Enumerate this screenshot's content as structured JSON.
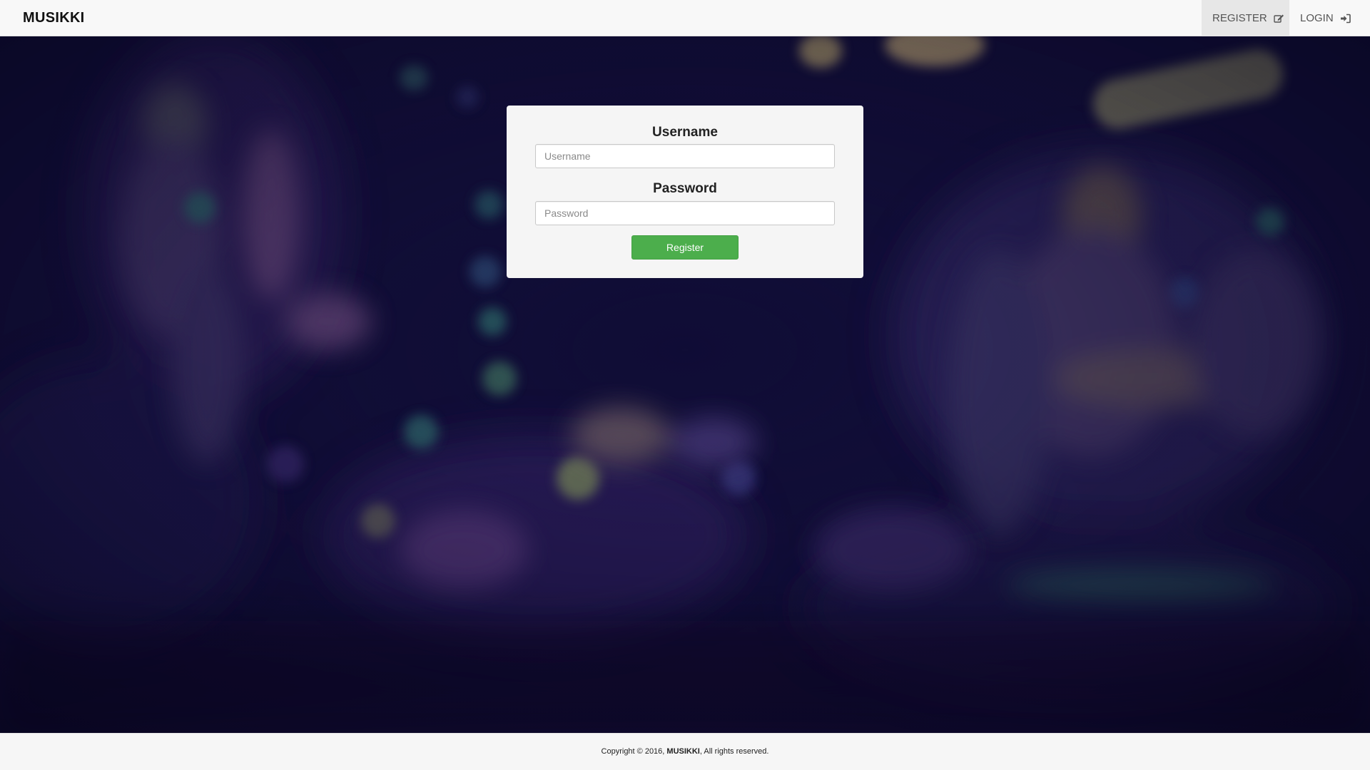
{
  "app": {
    "brand": "MUSIKKI"
  },
  "nav": {
    "items": [
      {
        "label": "REGISTER",
        "icon": "edit-icon",
        "active": true
      },
      {
        "label": "LOGIN",
        "icon": "sign-in-icon",
        "active": false
      }
    ]
  },
  "form": {
    "username_label": "Username",
    "username_placeholder": "Username",
    "username_value": "",
    "password_label": "Password",
    "password_placeholder": "Password",
    "password_value": "",
    "submit_label": "Register"
  },
  "footer": {
    "prefix": "Copyright © 2016, ",
    "brand": "MUSIKKI",
    "suffix": ", All rights reserved."
  },
  "colors": {
    "navbar_bg": "#f8f8f8",
    "active_nav_bg": "#e7e7e7",
    "card_bg": "#f5f5f5",
    "button_green": "#4cae4c",
    "background_dark": "#0f0c33"
  }
}
